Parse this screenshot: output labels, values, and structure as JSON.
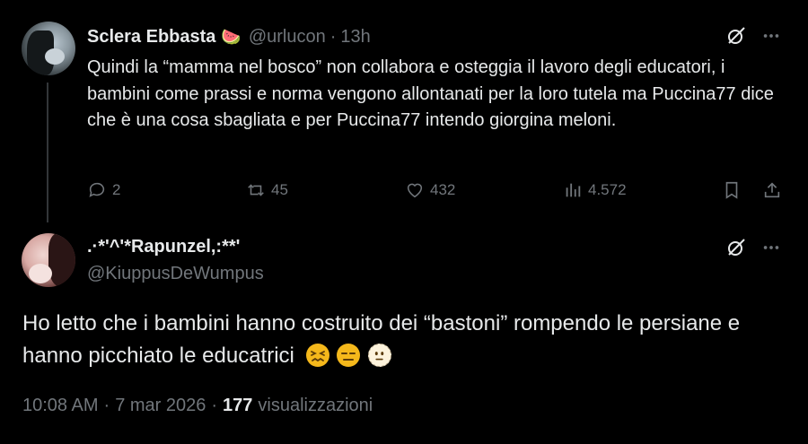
{
  "parent_tweet": {
    "display_name": "Sclera Ebbasta",
    "name_emoji": "🍉",
    "handle": "@urlucon",
    "separator": "·",
    "time": "13h",
    "text": "Quindi la “mamma nel bosco” non collabora e osteggia il lavoro degli educatori, i bambini come prassi e norma vengono allontanati per la loro tutela ma Puccina77 dice che è una cosa sbagliata e per Puccina77 intendo giorgina meloni.",
    "stats": {
      "replies": "2",
      "reposts": "45",
      "likes": "432",
      "views": "4.572"
    },
    "colors": {
      "accent_icon": "#e7e9ea",
      "muted": "#71767b",
      "thread_line": "#333639"
    }
  },
  "main_tweet": {
    "display_name": ".·*'^'*Rapunzel,:**'",
    "handle": "@KiuppusDeWumpus",
    "text": "Ho letto che i bambini hanno costruito dei “bastoni” rompendo le persiane e hanno picchiato le educatrici",
    "emojis": [
      "confounded-face",
      "expressionless-face",
      "dotted-line-face"
    ],
    "time": "10:08 AM",
    "separator1": "·",
    "date": "7 mar 2026",
    "separator2": "·",
    "views_count": "177",
    "views_label": "visualizzazioni"
  }
}
